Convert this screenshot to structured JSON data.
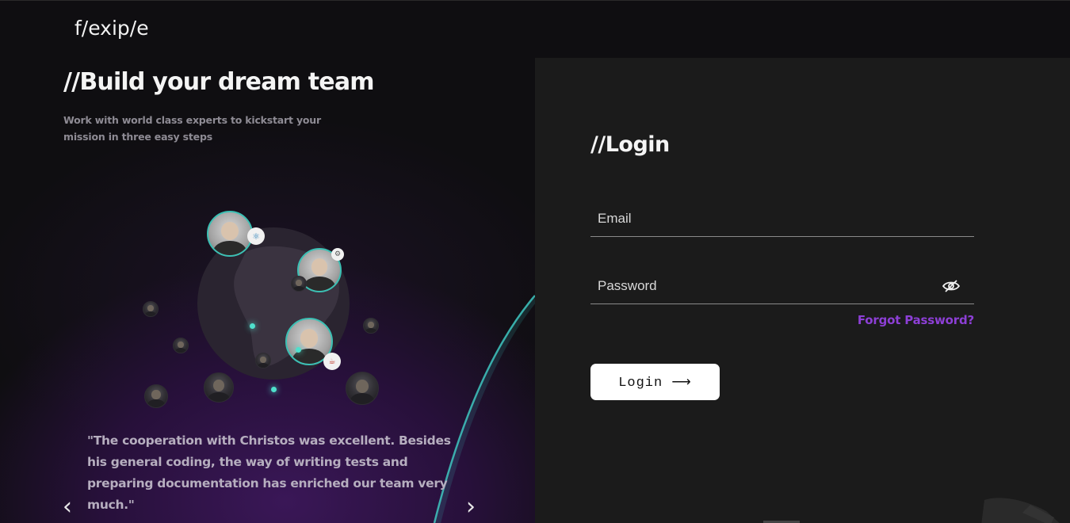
{
  "brand": {
    "logo": "f/exip/e"
  },
  "hero": {
    "title": "//Build your dream team",
    "subtitle": "Work with world class experts to kickstart your mission in three easy steps"
  },
  "testimonial": {
    "quote": "\"The cooperation with Christos was excellent. Besides his general coding, the way of writing tests and preparing documentation has enriched our team very much.\"",
    "prev_icon": "‹",
    "next_icon": "›"
  },
  "login": {
    "title": "//Login",
    "email_placeholder": "Email",
    "password_placeholder": "Password",
    "forgot_label": "Forgot Password?",
    "submit_label": "Login ⟶"
  },
  "colors": {
    "accent_purple": "#8d3fd6",
    "teal": "#3bc0b4",
    "panel": "#1b1b1b",
    "background": "#0f0e11"
  },
  "icons": {
    "eye_toggle": "eye-slash-icon",
    "prev": "chevron-left-icon",
    "next": "chevron-right-icon",
    "react_badge": "react-icon",
    "angular_badge": "gear-icon",
    "java_badge": "java-icon"
  }
}
